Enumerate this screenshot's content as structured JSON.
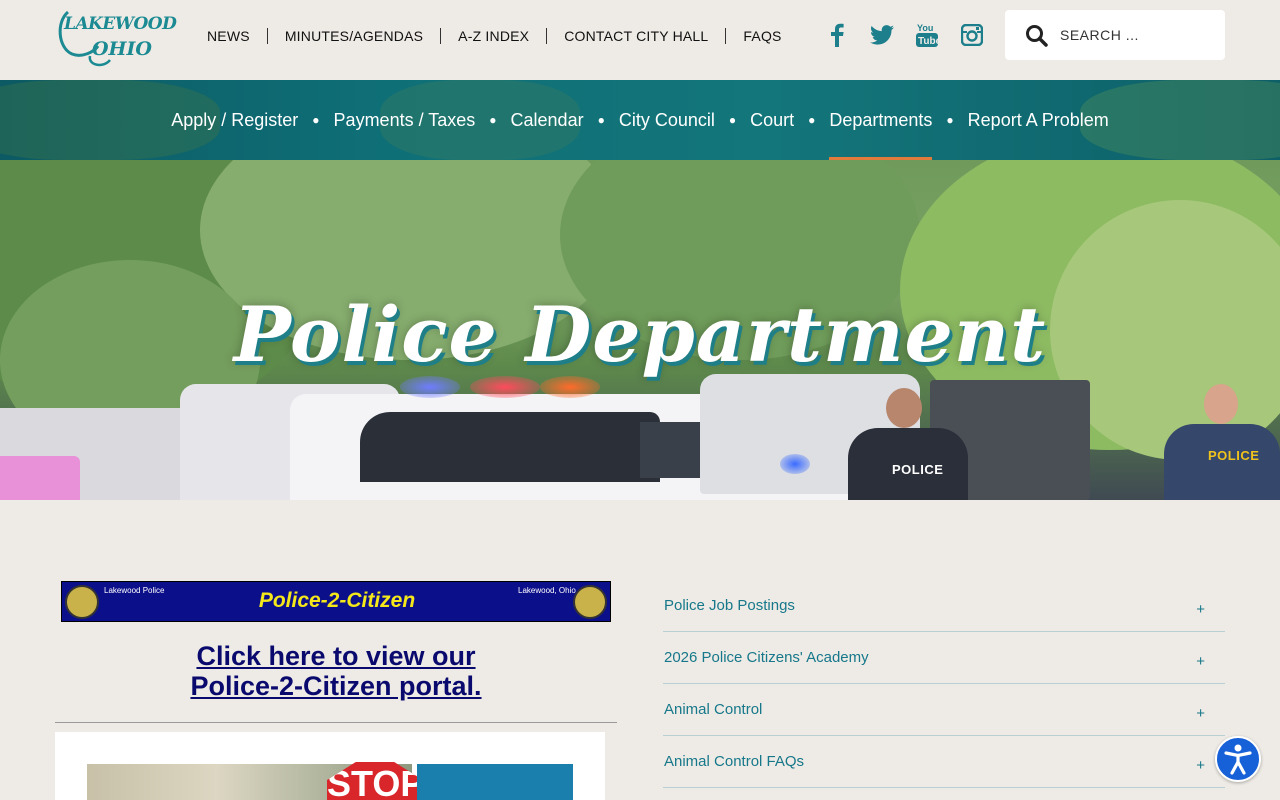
{
  "logo": {
    "line1": "LAKEWOOD",
    "line2": "OHIO"
  },
  "utility_nav": [
    {
      "label": "NEWS"
    },
    {
      "label": "MINUTES/AGENDAS"
    },
    {
      "label": "A-Z INDEX"
    },
    {
      "label": "CONTACT CITY HALL"
    },
    {
      "label": "FAQS"
    }
  ],
  "social": [
    "facebook-icon",
    "twitter-icon",
    "youtube-icon",
    "instagram-icon"
  ],
  "search": {
    "placeholder": "SEARCH ..."
  },
  "main_nav": [
    {
      "label": "Apply / Register"
    },
    {
      "label": "Payments / Taxes"
    },
    {
      "label": "Calendar"
    },
    {
      "label": "City Council"
    },
    {
      "label": "Court"
    },
    {
      "label": "Departments",
      "active": true
    },
    {
      "label": "Report A Problem"
    }
  ],
  "hero": {
    "title": "Police Department",
    "badge1": "POLICE",
    "badge2": "POLICE"
  },
  "banner": {
    "left": "Lakewood Police",
    "right": "Lakewood, Ohio",
    "title": "Police-2-Citizen"
  },
  "portal": {
    "line1": "Click here to view our",
    "line2": "Police-2-Citizen portal."
  },
  "card": {
    "stop": "STOP"
  },
  "accordion": [
    {
      "label": "Police Job Postings"
    },
    {
      "label": "2026 Police Citizens' Academy"
    },
    {
      "label": "Animal Control"
    },
    {
      "label": "Animal Control FAQs"
    }
  ],
  "accordion_toggle": "+",
  "colors": {
    "teal": "#16788a",
    "accent": "#e07b3c",
    "banner_blue": "#0c0f8a",
    "banner_yellow": "#f5e81a"
  }
}
